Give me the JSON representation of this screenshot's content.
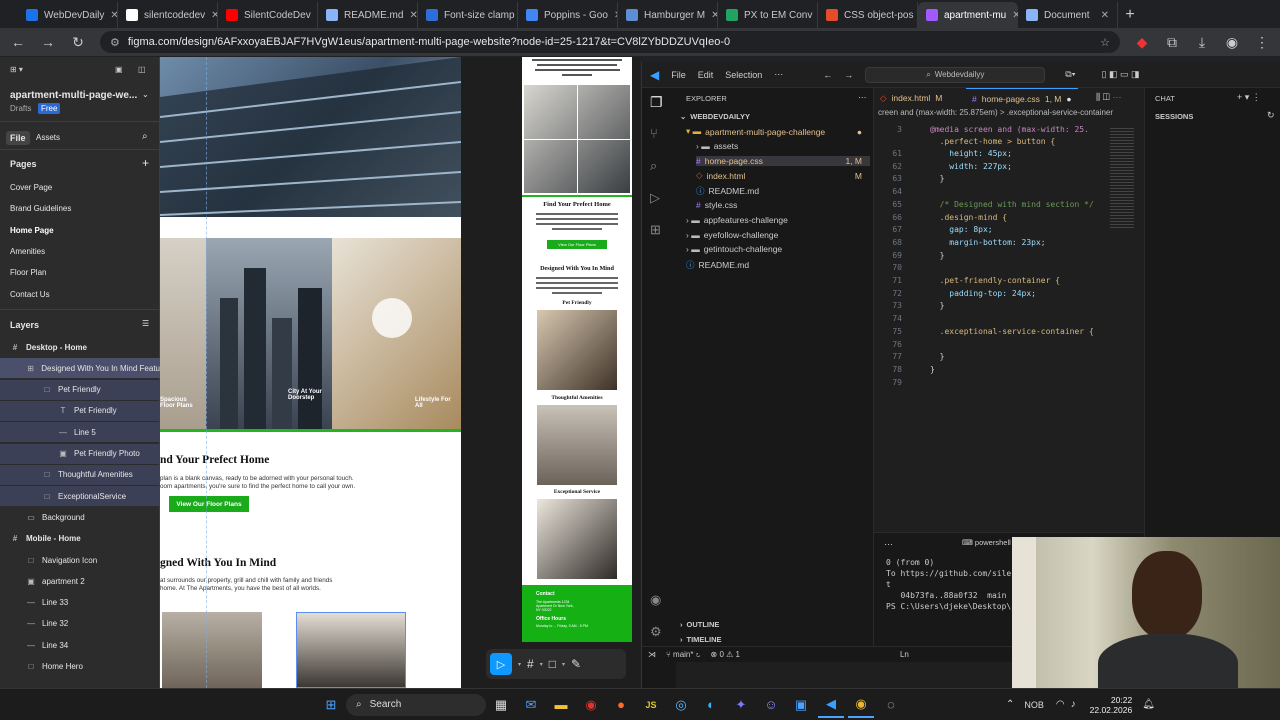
{
  "browser": {
    "tabs": [
      {
        "label": "WebDevDaily",
        "color": "#1a73e8"
      },
      {
        "label": "silentcodedev",
        "color": "#ffffff"
      },
      {
        "label": "SilentCodeDev",
        "color": "#ff0000"
      },
      {
        "label": "README.md",
        "color": "#8ab4f8"
      },
      {
        "label": "Font-size clamp",
        "color": "#2d6fd6"
      },
      {
        "label": "Poppins - Goo",
        "color": "#4285f4"
      },
      {
        "label": "Hamburger M",
        "color": "#5f8dd3"
      },
      {
        "label": "PX to EM Conv",
        "color": "#21a366"
      },
      {
        "label": "CSS object-pos",
        "color": "#e44d26"
      },
      {
        "label": "apartment-mu",
        "color": "#a259ff"
      },
      {
        "label": "Document",
        "color": "#8ab4f8"
      }
    ],
    "new_tab": "+",
    "url": "figma.com/design/6AFxxoyaEBJAF7HVgW1eus/apartment-multi-page-website?node-id=25-1217&t=CV8lZYbDDZUVqIeo-0"
  },
  "figma": {
    "project_name": "apartment-multi-page-we...",
    "drafts": "Drafts",
    "plan": "Free",
    "file_tab": "File",
    "assets_tab": "Assets",
    "pages_heading": "Pages",
    "pages": [
      "Cover Page",
      "Brand Guidelines",
      "Home Page",
      "Amenities",
      "Floor Plan",
      "Contact Us"
    ],
    "layers_heading": "Layers",
    "layers": [
      {
        "label": "Desktop - Home",
        "icon": "#"
      },
      {
        "label": "Designed With You In Mind Featu",
        "icon": "⊞"
      },
      {
        "label": "Pet Friendly",
        "icon": "□"
      },
      {
        "label": "Pet Friendly",
        "icon": "T"
      },
      {
        "label": "Line 5",
        "icon": "—"
      },
      {
        "label": "Pet Friendly Photo",
        "icon": "▣"
      },
      {
        "label": "Thoughtful Amenities",
        "icon": "□"
      },
      {
        "label": "ExceptionalService",
        "icon": "□"
      },
      {
        "label": "Background",
        "icon": "▭"
      },
      {
        "label": "Mobile - Home",
        "icon": "#"
      },
      {
        "label": "Navigation Icon",
        "icon": "□"
      },
      {
        "label": "apartment 2",
        "icon": "▣"
      },
      {
        "label": "Line 33",
        "icon": "—"
      },
      {
        "label": "Line 32",
        "icon": "—"
      },
      {
        "label": "Line 34",
        "icon": "—"
      },
      {
        "label": "Home Hero",
        "icon": "□"
      }
    ],
    "desktop": {
      "photo_labels": [
        "Spacious Floor Plans",
        "City At Your Doorstep",
        "Lifestyle For All"
      ],
      "find_heading": "nd Your Prefect Home",
      "find_text_1": "plan is a blank canvas, ready to be adorned with your personal touch.",
      "find_text_2": "oom apartments, you're sure to find the perfect home to call your own.",
      "floor_button": "View Our Floor Plans",
      "designed_heading": "gned With You In Mind",
      "designed_text_1": "at surrounds our property, grill and chill with family and friends",
      "designed_text_2": "home. At The Apartments, you have the best of all worlds."
    },
    "mobile": {
      "find_heading": "Find Your Prefect Home",
      "floor_button": "View Our Floor Plans",
      "designed_heading": "Designed With You In Mind",
      "cards": [
        "Pet Friendly",
        "Thoughtful Amenities",
        "Exceptional Service"
      ],
      "contact": "Contact",
      "address": "The Apartments 1234 Apartment Dr New York, NY 00022",
      "office": "Office Hours",
      "hours": "Monday to ... Friday, 9 AM - 5 PM"
    },
    "tools": [
      "▷",
      "#",
      "□",
      "✎"
    ]
  },
  "vscode": {
    "menu": [
      "File",
      "Edit",
      "Selection",
      "⋯"
    ],
    "search": "Webdevdailyy",
    "explorer_title": "EXPLORER",
    "workspace": "WEBDEVDAILYY",
    "tree": [
      {
        "label": "apartment-multi-page-challenge",
        "indent": 1,
        "type": "folder-open",
        "color": "#e2c08d",
        "badge": "●"
      },
      {
        "label": "assets",
        "indent": 2,
        "type": "folder",
        "color": "#ccc",
        "badge": ""
      },
      {
        "label": "home-page.css",
        "indent": 2,
        "type": "css",
        "color": "#e2c08d",
        "badge": "1, M"
      },
      {
        "label": "index.html",
        "indent": 2,
        "type": "html",
        "color": "#e2c08d",
        "badge": "M"
      },
      {
        "label": "README.md",
        "indent": 2,
        "type": "md",
        "color": "#ccc",
        "badge": ""
      },
      {
        "label": "style.css",
        "indent": 2,
        "type": "css",
        "color": "#ccc",
        "badge": ""
      },
      {
        "label": "appfeatures-challenge",
        "indent": 1,
        "type": "folder",
        "color": "#ccc",
        "badge": ""
      },
      {
        "label": "eyefollow-challenge",
        "indent": 1,
        "type": "folder",
        "color": "#ccc",
        "badge": ""
      },
      {
        "label": "getintouch-challenge",
        "indent": 1,
        "type": "folder",
        "color": "#ccc",
        "badge": ""
      },
      {
        "label": "README.md",
        "indent": 1,
        "type": "md",
        "color": "#ccc",
        "badge": ""
      }
    ],
    "outline": "OUTLINE",
    "timeline": "TIMELINE",
    "tabs": [
      {
        "label": "index.html",
        "badge": "M"
      },
      {
        "label": "home-page.css",
        "badge": "1, M"
      }
    ],
    "breadcrumb": "creen and (max-width: 25.875em) > .exceptional-service-container",
    "sticky_line": {
      "num": "3",
      "text": "@media screen and (max-width: 25."
    },
    "sticky_line2": {
      "num": "",
      "text": "  .perfect-home > button {"
    },
    "code": [
      {
        "num": "61",
        "text": "    height: 45px;"
      },
      {
        "num": "62",
        "text": "    width: 227px;"
      },
      {
        "num": "63",
        "text": "  }"
      },
      {
        "num": "64",
        "text": ""
      },
      {
        "num": "65",
        "text": "  /* Designed with mind section */"
      },
      {
        "num": "66",
        "text": "  .design-mind {"
      },
      {
        "num": "67",
        "text": "    gap: 8px;"
      },
      {
        "num": "68",
        "text": "    margin-bottom: 23px;"
      },
      {
        "num": "69",
        "text": "  }"
      },
      {
        "num": "70",
        "text": ""
      },
      {
        "num": "71",
        "text": "  .pet-friendly-container {"
      },
      {
        "num": "72",
        "text": "    padding-top: 24px;"
      },
      {
        "num": "73",
        "text": "  }"
      },
      {
        "num": "74",
        "text": ""
      },
      {
        "num": "75",
        "text": "  .exceptional-service-container {"
      },
      {
        "num": "76",
        "text": ""
      },
      {
        "num": "77",
        "text": "  }"
      },
      {
        "num": "78",
        "text": "}"
      },
      {
        "num": "79",
        "text": ""
      }
    ],
    "chat_title": "CHAT",
    "sessions": "SESSIONS",
    "terminal_label": "powershell",
    "terminal_lines": [
      "0 (from 0)",
      "To https://github.com/siler",
      "t",
      "   04b73fa..88a0f32  main -",
      "PS C:\\Users\\djeke\\Desktop\\"
    ],
    "status_branch": "main*",
    "status_problems": "⊗ 0 ⚠ 1",
    "status_ln": "Ln"
  },
  "taskbar": {
    "search": "Search",
    "lang": "NOB",
    "time": "20:22",
    "date": "22.02.2026"
  }
}
